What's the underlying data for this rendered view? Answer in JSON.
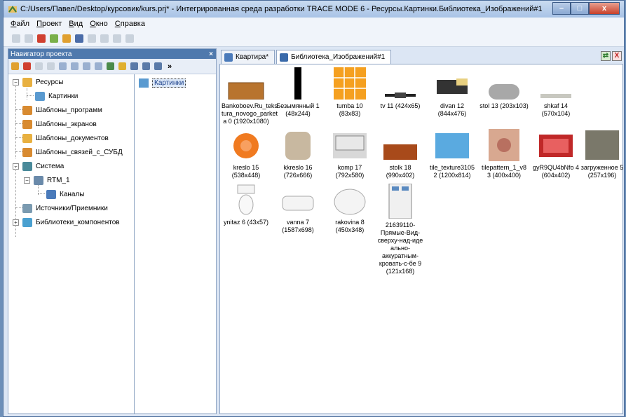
{
  "window": {
    "title": "C:/Users/Павел/Desktop/курсовик/kurs.prj* - Интегрированная среда разработки TRACE MODE 6 - Ресурсы.Картинки.Библиотека_Изображений#1",
    "controls": {
      "minimize": "–",
      "maximize": "□",
      "close": "x"
    }
  },
  "menu": [
    "Файл",
    "Проект",
    "Вид",
    "Окно",
    "Справка"
  ],
  "navigator": {
    "title": "Навигатор проекта",
    "close": "×",
    "more": "»",
    "tree": [
      {
        "label": "Ресурсы"
      },
      {
        "label": "Картинки"
      },
      {
        "label": "Шаблоны_программ"
      },
      {
        "label": "Шаблоны_экранов"
      },
      {
        "label": "Шаблоны_документов"
      },
      {
        "label": "Шаблоны_связей_с_СУБД"
      },
      {
        "label": "Система"
      },
      {
        "label": "RTM_1"
      },
      {
        "label": "Каналы"
      },
      {
        "label": "Источники/Приемники"
      },
      {
        "label": "Библиотеки_компонентов"
      }
    ],
    "selected_item": "Картинки"
  },
  "tabs": [
    {
      "label": "Квартира*"
    },
    {
      "label": "Библиотека_Изображений#1"
    }
  ],
  "tab_controls": {
    "restore": "⇄",
    "close": "X"
  },
  "gallery": [
    {
      "name": "Bankoboev.Ru_teks tura_novogo_parket a 0 (1920x1080)"
    },
    {
      "name": "Безымянный 1 (48x244)"
    },
    {
      "name": "tumba 10 (83x83)"
    },
    {
      "name": "tv 11 (424x65)"
    },
    {
      "name": "divan 12 (844x476)"
    },
    {
      "name": "stol 13 (203x103)"
    },
    {
      "name": "shkaf 14 (570x104)"
    },
    {
      "name": "kreslo 15 (538x448)"
    },
    {
      "name": "kkreslo 16 (726x666)"
    },
    {
      "name": "komp 17 (792x580)"
    },
    {
      "name": "stolk 18 (990x402)"
    },
    {
      "name": "tile_texture3105 2 (1200x814)"
    },
    {
      "name": "tilepattern_1_v8 3 (400x400)"
    },
    {
      "name": "gyR9QU4bNfo 4 (604x402)"
    },
    {
      "name": "загруженное 5 (257x196)"
    },
    {
      "name": "ynitaz 6 (43x57)"
    },
    {
      "name": "vanna 7 (1587x698)"
    },
    {
      "name": "rakovina 8 (450x348)"
    },
    {
      "name": "21639110-Прямые-Вид-сверху-над-иде ально-аккуратным-кровать-с-бе 9 (121x168)"
    }
  ]
}
